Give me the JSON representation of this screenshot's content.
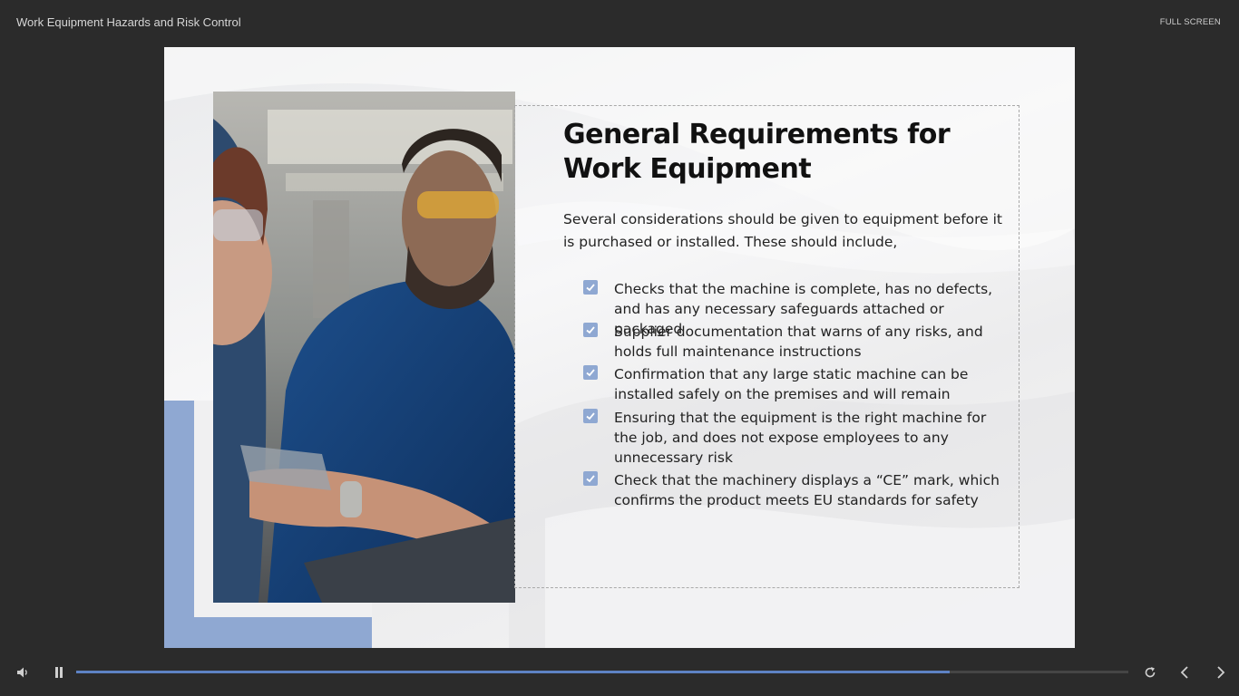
{
  "header": {
    "course_title": "Work Equipment Hazards and Risk Control",
    "full_screen_label": "FULL SCREEN"
  },
  "slide": {
    "heading": "General Requirements for Work Equipment",
    "intro": "Several considerations should be given to equipment before it is purchased or installed. These should include,",
    "checklist": [
      "Checks that the machine is complete, has no defects, and has any necessary safeguards attached or packaged",
      "Supplier documentation that warns of any risks, and holds full maintenance instructions",
      "Confirmation that any large static machine can be installed safely on the premises and will remain",
      "Ensuring that the equipment is the right machine for the job, and does not expose employees to any unnecessary risk",
      "Check that the machinery displays a “CE” mark, which confirms the product meets EU standards for safety"
    ],
    "photo_description_icon": "workers-with-safety-glasses-photo"
  },
  "player": {
    "progress_fraction": 0.83,
    "icons": [
      "volume-icon",
      "pause-icon",
      "replay-icon",
      "previous-icon",
      "next-icon"
    ]
  },
  "colors": {
    "background": "#2b2b2b",
    "accent": "#8fa8d2",
    "progress": "#5e82c4"
  }
}
